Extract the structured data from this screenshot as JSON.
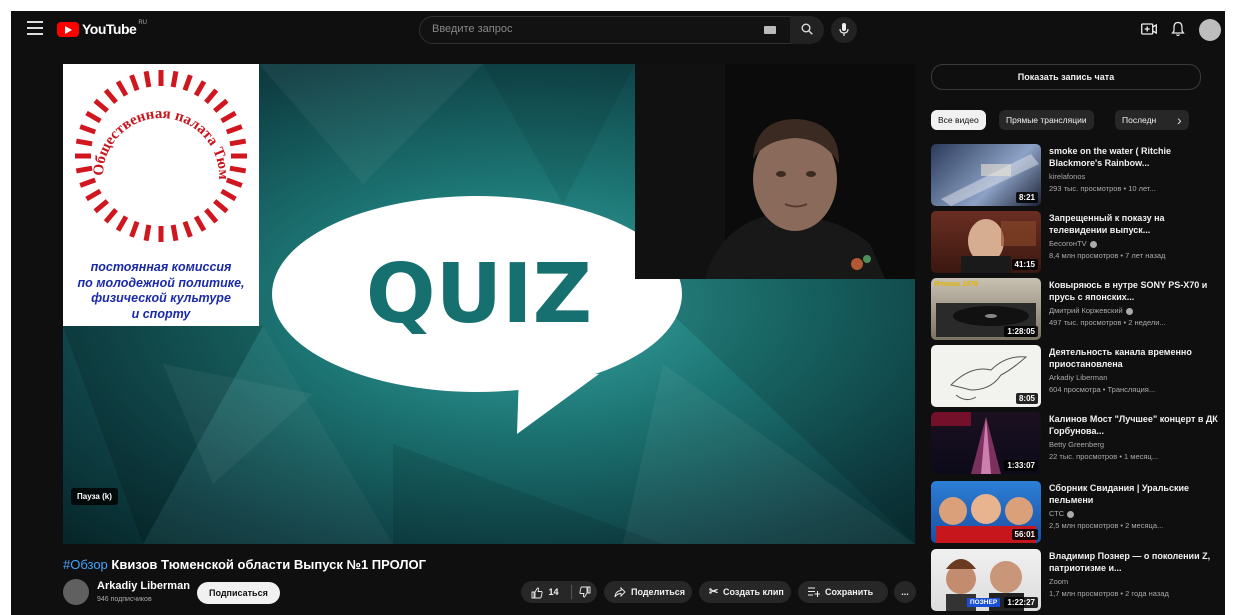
{
  "header": {
    "logo_text": "YouTube",
    "logo_country": "RU",
    "search_placeholder": "Введите запрос",
    "icons": [
      "menu-icon",
      "keyboard-icon",
      "search-icon",
      "mic-icon",
      "create-icon",
      "bell-icon",
      "avatar"
    ]
  },
  "player": {
    "logo_box_arc": "Общественная палата Тюменской области",
    "commission_lines": [
      "постоянная комиссия",
      "по молодежной политике,",
      "физической культуре",
      "и спорту"
    ],
    "quiz_text": "QUIZ",
    "pause_tooltip": "Пауза (k)"
  },
  "video": {
    "hashtag": "#Обзор",
    "title": "Квизов Тюменской области Выпуск №1 ПРОЛОГ",
    "channel_name": "Arkadiy Liberman",
    "subscribers": "946 подписчиков",
    "subscribe_label": "Подписаться",
    "likes": "14",
    "share_label": "Поделиться",
    "clip_label": "Создать клип",
    "save_label": "Сохранить",
    "more_label": "..."
  },
  "sidebar": {
    "chat_button": "Показать запись чата",
    "chips": [
      "Все видео",
      "Прямые трансляции",
      "Последн"
    ],
    "recommendations": [
      {
        "title": "smoke on the water ( Ritchie Blackmore's Rainbow...",
        "channel": "kirelafonos",
        "meta": "293 тыс. просмотров • 10 лет...",
        "duration": "8:21",
        "verified": false
      },
      {
        "title": "Запрещенный к показу на телевидении выпуск...",
        "channel": "БесогонTV",
        "meta": "8,4 млн просмотров • 7 лет назад",
        "duration": "41:15",
        "verified": true
      },
      {
        "title": "Ковыряюсь в нутре SONY PS-X70 и прусь с японских...",
        "channel": "Дмитрий Коржевский",
        "meta": "497 тыс. просмотров • 2 недели...",
        "duration": "1:28:05",
        "thumb_label": "Японии 1978",
        "verified": true
      },
      {
        "title": "Деятельность канала временно приостановлена",
        "channel": "Arkadiy Liberman",
        "meta": "604 просмотра • Трансляция...",
        "duration": "8:05",
        "verified": false
      },
      {
        "title": "Калинов Мост \"Лучшее\" концерт в ДК Горбунова...",
        "channel": "Betty Greenberg",
        "meta": "22 тыс. просмотров • 1 месяц...",
        "duration": "1:33:07",
        "verified": false
      },
      {
        "title": "Сборник Свидания | Уральские пельмени",
        "channel": "СТС",
        "meta": "2,5 млн просмотров • 2 месяца...",
        "duration": "56:01",
        "verified": true
      },
      {
        "title": "Владимир Познер — о поколении Z, патриотизме и...",
        "channel": "Zoom",
        "meta": "1,7 млн просмотров • 2 года назад",
        "duration": "1:22:27",
        "thumb_label": "ПОЗНЕР",
        "verified": false
      }
    ]
  }
}
